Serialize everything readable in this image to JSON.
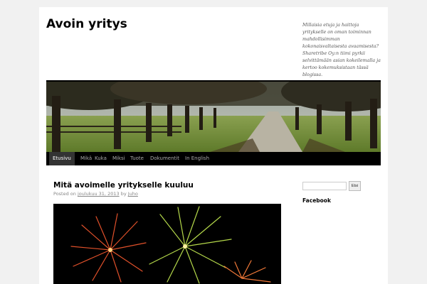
{
  "site": {
    "title": "Avoin yritys",
    "description": "Millaisia etuja ja haittoja yritykselle on oman toiminnan mahdollisimman kokonaisvaltaisesta avaamisesta? Sharetribe Oy:n tiimi pyrkii selvittämään asian kokeilemalla ja kertoo kokemuksistaan tässä blogissa."
  },
  "nav": {
    "items": [
      {
        "label": "Etusivu",
        "current": true
      },
      {
        "label": "Mikä"
      },
      {
        "label": "Kuka"
      },
      {
        "label": "Miksi"
      },
      {
        "label": "Tuote"
      },
      {
        "label": "Dokumentit"
      },
      {
        "label": "In English"
      }
    ]
  },
  "post": {
    "title": "Mitä avoimelle yritykselle kuuluu",
    "posted_on": "Posted on",
    "date": "joulukuu 31, 2013",
    "by": "by",
    "author": "Juho"
  },
  "sidebar": {
    "search_placeholder": "",
    "search_button": "Etsi",
    "widget_title": "Facebook"
  },
  "colors": {
    "nav_bg": "#000000",
    "nav_current_bg": "#333333",
    "nav_text": "#aaaaaa"
  }
}
